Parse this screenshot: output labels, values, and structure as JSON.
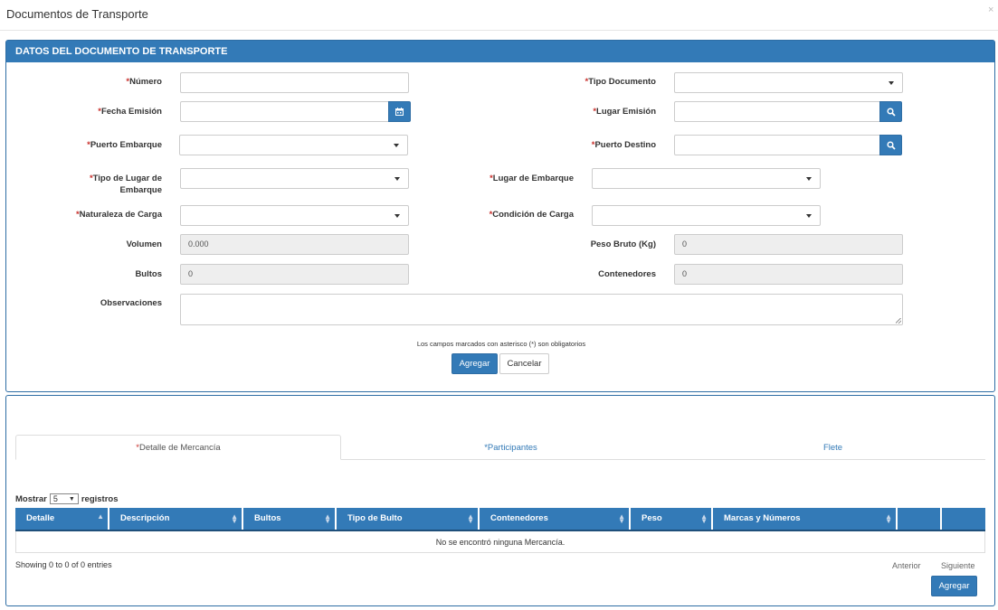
{
  "modal": {
    "title": "Documentos de Transporte",
    "close_glyph": "×"
  },
  "panel1": {
    "heading": "DATOS DEL DOCUMENTO DE TRANSPORTE",
    "required_marker": "*",
    "fields": {
      "numero": {
        "label": "Número",
        "value": ""
      },
      "tipo_documento": {
        "label": "Tipo Documento",
        "value": ""
      },
      "fecha_emision": {
        "label": "Fecha Emisión",
        "value": ""
      },
      "lugar_emision": {
        "label": "Lugar Emisión",
        "value": ""
      },
      "puerto_embarque": {
        "label": "Puerto Embarque",
        "value": ""
      },
      "puerto_destino": {
        "label": "Puerto Destino",
        "value": ""
      },
      "tipo_lugar_embarque": {
        "label_line1": "Tipo de Lugar de",
        "label_line2": "Embarque",
        "value": ""
      },
      "lugar_embarque": {
        "label": "Lugar de Embarque",
        "value": ""
      },
      "naturaleza_carga": {
        "label": "Naturaleza de Carga",
        "value": ""
      },
      "condicion_carga": {
        "label": "Condición de Carga",
        "value": ""
      },
      "volumen": {
        "label": "Volumen",
        "value": "0.000"
      },
      "peso_bruto": {
        "label": "Peso Bruto (Kg)",
        "value": "0"
      },
      "bultos": {
        "label": "Bultos",
        "value": "0"
      },
      "contenedores": {
        "label": "Contenedores",
        "value": "0"
      },
      "observaciones": {
        "label": "Observaciones",
        "value": ""
      }
    },
    "note": "Los campos marcados con asterisco (*) son obligatorios",
    "buttons": {
      "agregar": "Agregar",
      "cancelar": "Cancelar"
    }
  },
  "panel2": {
    "tabs": [
      {
        "label": "Detalle de Mercancía",
        "required": true,
        "active": true
      },
      {
        "label": "Participantes",
        "required": true,
        "active": false
      },
      {
        "label": "Flete",
        "required": false,
        "active": false
      }
    ],
    "length_menu": {
      "prefix": "Mostrar",
      "selected": "5",
      "suffix": "registros"
    },
    "columns": [
      "Detalle",
      "Descripción",
      "Bultos",
      "Tipo de Bulto",
      "Contenedores",
      "Peso",
      "Marcas y Números",
      "",
      ""
    ],
    "empty_message": "No se encontró ninguna Mercancía.",
    "info": "Showing 0 to 0 of 0 entries",
    "pager": {
      "prev": "Anterior",
      "next": "Siguiente"
    },
    "add_button": "Agregar"
  },
  "icons": [
    "calendar-icon",
    "search-icon",
    "caret-down-icon",
    "sort-icon"
  ],
  "colors": {
    "primary": "#337ab7",
    "required": "#c9302c",
    "readonly_bg": "#eeeeee"
  }
}
